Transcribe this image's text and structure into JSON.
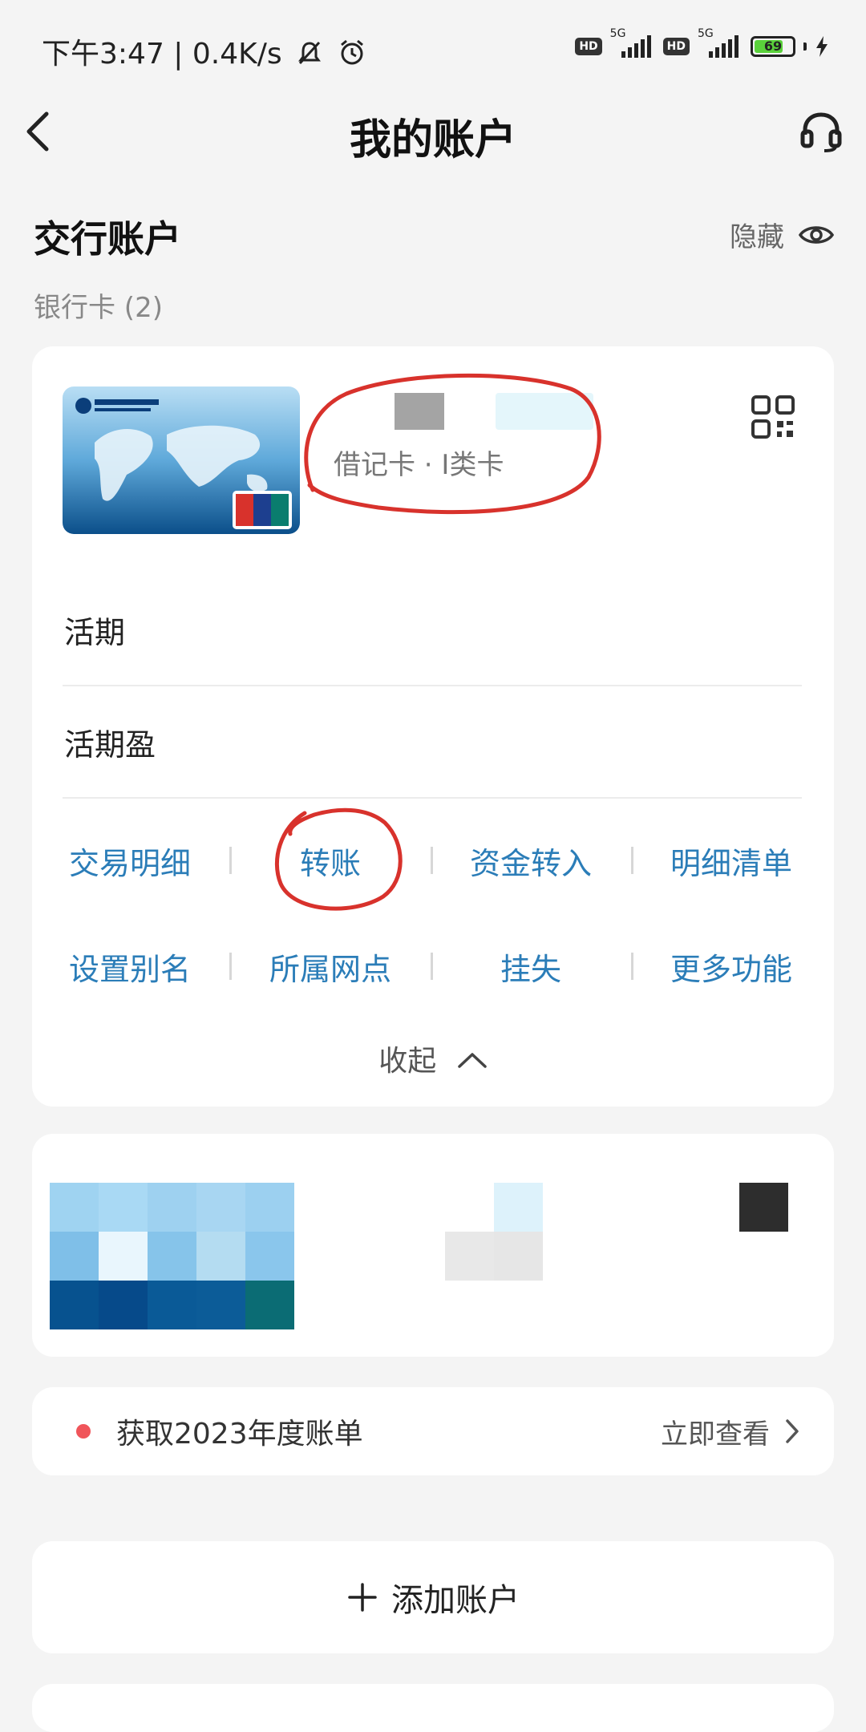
{
  "status_bar": {
    "time": "下午3:47 | 0.4K/s",
    "network_label": "5G",
    "hd_label": "HD",
    "battery": "69"
  },
  "nav": {
    "title": "我的账户"
  },
  "section": {
    "title": "交行账户",
    "hide_label": "隐藏",
    "card_count": "银行卡 (2)"
  },
  "card": {
    "type_label": "借记卡 · I类卡"
  },
  "accounts": [
    {
      "label": "活期"
    },
    {
      "label": "活期盈"
    }
  ],
  "actions": [
    {
      "label": "交易明细"
    },
    {
      "label": "转账"
    },
    {
      "label": "资金转入"
    },
    {
      "label": "明细清单"
    },
    {
      "label": "设置别名"
    },
    {
      "label": "所属网点"
    },
    {
      "label": "挂失"
    },
    {
      "label": "更多功能"
    }
  ],
  "collapse_label": "收起",
  "bill": {
    "text": "获取2023年度账单",
    "link_label": "立即查看"
  },
  "add_account_label": "添加账户",
  "colors": {
    "accent": "#2b7db8",
    "annotation_red": "#d8322c",
    "notice_dot": "#f0555a"
  }
}
